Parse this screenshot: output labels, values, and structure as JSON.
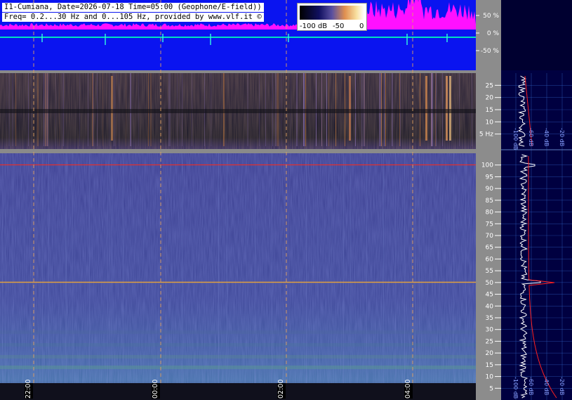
{
  "header": {
    "line1": "I1-Cumiana, Date=2026-07-18 Time=05:00 (Geophone/E-field))",
    "line2": "Freq= 0.2...30 Hz and 0...105 Hz, provided by www.vlf.it ©"
  },
  "colorbar": {
    "labels": [
      "-100 dB",
      "-50",
      "0"
    ]
  },
  "waveform": {
    "percent_labels": [
      "50 %",
      "0 %",
      "-50 %"
    ]
  },
  "elf_spectrogram": {
    "freq_labels": [
      "25",
      "20",
      "15",
      "10",
      "5 Hz"
    ],
    "freq_ticks": [
      25,
      20,
      15,
      10,
      5
    ],
    "freq_range": [
      0,
      30
    ]
  },
  "vlf_spectrogram": {
    "freq_labels": [
      "100",
      "95",
      "90",
      "85",
      "80",
      "75",
      "70",
      "65",
      "60",
      "55",
      "50",
      "45",
      "40",
      "35",
      "30",
      "25",
      "20",
      "15",
      "10",
      "5"
    ],
    "freq_ticks": [
      100,
      95,
      90,
      85,
      80,
      75,
      70,
      65,
      60,
      55,
      50,
      45,
      40,
      35,
      30,
      25,
      20,
      15,
      10,
      5
    ],
    "freq_range": [
      0,
      105
    ]
  },
  "time_labels": [
    "22:00",
    "00:00",
    "02:00",
    "04:00"
  ],
  "side_spectrum_top": {
    "db_labels": [
      "-100 dB",
      "-60 dB",
      "-40 dB",
      "-20 dB"
    ]
  },
  "side_spectrum_bottom": {
    "db_labels": [
      "-100 dB",
      "-60 dB",
      "-40 dB",
      "-20 dB"
    ]
  },
  "colors": {
    "waveform_bg": "#0a14f0",
    "waveform_peak": "#ff10ff",
    "waveform_trace": "#00e0c0",
    "grid": "#9a9a9a",
    "dashed_marker": "#e0a060",
    "hum_line": "#e03030",
    "side_bg": "#000040",
    "side_grid": "#3060c0",
    "side_trace": "#ffffff",
    "side_fit": "#ff2020"
  }
}
